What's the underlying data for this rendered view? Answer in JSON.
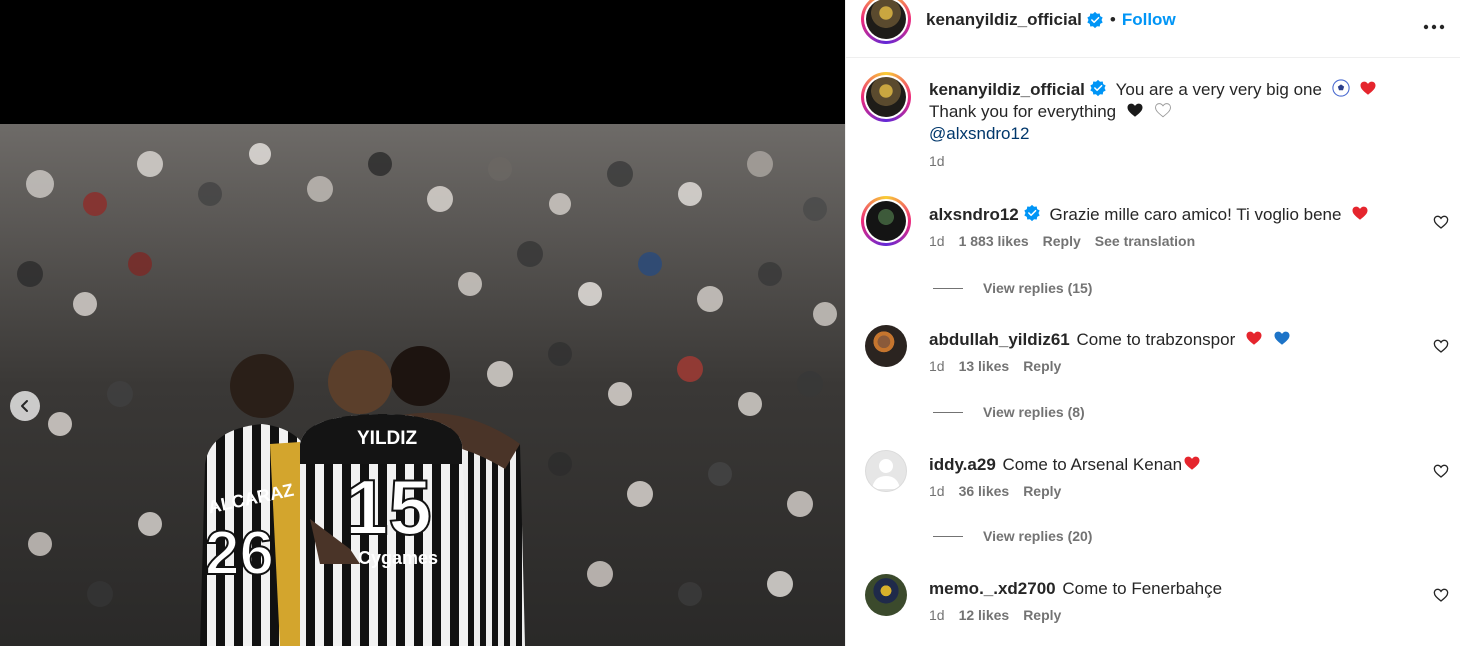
{
  "post": {
    "author": "kenanyildiz_official",
    "follow_label": "Follow",
    "separator": "•"
  },
  "caption": {
    "username": "kenanyildiz_official",
    "line1": "You are a very very big one",
    "line2": "Thank you for everything",
    "mention": "@alxsndro12",
    "time": "1d"
  },
  "comments": [
    {
      "username": "alxsndro12",
      "verified": true,
      "text": "Grazie mille caro amico! Ti voglio bene",
      "time": "1d",
      "likes": "1 883 likes",
      "reply_label": "Reply",
      "see_translation": "See translation",
      "view_replies": "View replies (15)"
    },
    {
      "username": "abdullah_yildiz61",
      "verified": false,
      "text": "Come to trabzonspor",
      "time": "1d",
      "likes": "13 likes",
      "reply_label": "Reply",
      "view_replies": "View replies (8)"
    },
    {
      "username": "iddy.a29",
      "verified": false,
      "text": "Come to Arsenal Kenan",
      "time": "1d",
      "likes": "36 likes",
      "reply_label": "Reply",
      "view_replies": "View replies (20)"
    },
    {
      "username": "memo._.xd2700",
      "verified": false,
      "text": "Come to Fenerbahçe",
      "time": "1d",
      "likes": "12 likes",
      "reply_label": "Reply"
    }
  ],
  "photo": {
    "jersey_name": "YILDIZ",
    "jersey_number": "15",
    "left_player_name": "ALCARAZ",
    "left_player_number": "26",
    "sponsor": "Cygames"
  },
  "icons": {
    "verified": "verified-badge-icon",
    "more": "more-horizontal-icon",
    "like": "heart-outline-icon",
    "prev": "chevron-left-icon"
  },
  "colors": {
    "accent_blue": "#0095f6",
    "verified_blue": "#0095f6",
    "heart_red": "#e5252d",
    "heart_blue": "#1d74c8",
    "meta_gray": "#737373"
  }
}
